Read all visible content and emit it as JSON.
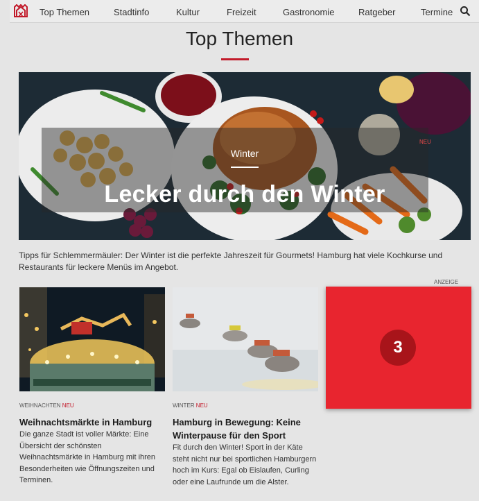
{
  "nav": {
    "logo_icon": "hamburg-logo-icon",
    "items": [
      "Top Themen",
      "Stadtinfo",
      "Kultur",
      "Freizeit",
      "Gastronomie",
      "Ratgeber",
      "Termine"
    ],
    "search_icon": "search-icon"
  },
  "page_title": "Top Themen",
  "hero": {
    "kicker": "Winter",
    "badge": "NEU",
    "title": "Lecker durch den Winter",
    "description": "Tipps für Schlemmermäuler: Der Winter ist die perfekte Jahreszeit für Gourmets! Hamburg hat viele Kochkurse und Restaurants für leckere Menüs im Angebot."
  },
  "cards": [
    {
      "kicker": "WEIHNACHTEN",
      "badge": "NEU",
      "title": "Weihnachtsmärkte in Hamburg",
      "text": "Die ganze Stadt ist voller Märkte: Eine Übersicht der schönsten Weihnachtsmärkte in Hamburg mit ihren Besonderheiten wie Öffnungszeiten und Terminen."
    },
    {
      "kicker": "WINTER",
      "badge": "NEU",
      "title": "Hamburg in Bewegung: Keine Winterpause für den Sport",
      "text": "Fit durch den Winter! Sport in der Käte steht nicht nur bei sportlichen Hamburgern hoch im Kurs: Egal ob Eislaufen, Curling oder eine Laufrunde um die Alster."
    }
  ],
  "ad": {
    "label": "ANZEIGE",
    "number": "3"
  },
  "colors": {
    "accent": "#c21a2a",
    "ad_background": "#e8252f",
    "page_background": "#e5e5e5"
  }
}
